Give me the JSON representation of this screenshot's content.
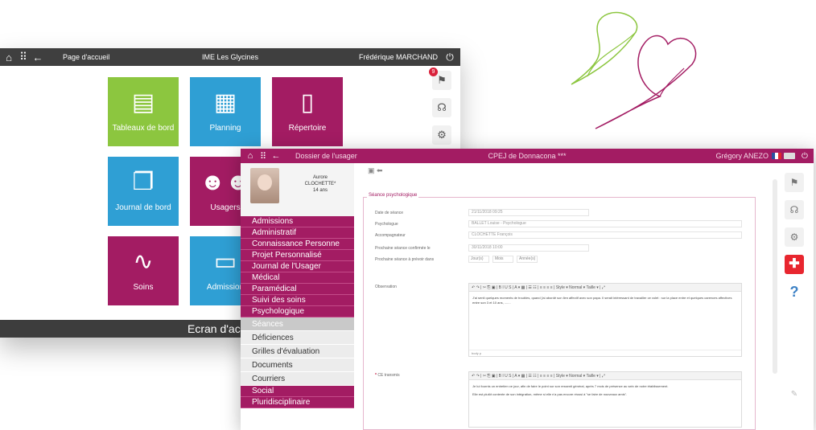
{
  "home_window": {
    "topbar": {
      "page_label": "Page d'accueil",
      "center_title": "IME Les Glycines",
      "user_name": "Frédérique MARCHAND"
    },
    "tiles": [
      {
        "label": "Tableaux de bord",
        "icon": "clipboard-icon",
        "color": "#8cc63f"
      },
      {
        "label": "Planning",
        "icon": "calendar-icon",
        "color": "#2f9fd4"
      },
      {
        "label": "Répertoire",
        "icon": "phone-icon",
        "color": "#a31c63"
      },
      {
        "label": "Journal de bord",
        "icon": "book-icon",
        "color": "#2f9fd4"
      },
      {
        "label": "Usagers",
        "icon": "users-icon",
        "color": "#a31c63"
      },
      {
        "label": "Soins",
        "icon": "stethoscope-icon",
        "color": "#a31c63"
      },
      {
        "label": "Admission",
        "icon": "id-card-icon",
        "color": "#2f9fd4"
      }
    ],
    "notification_count": "9",
    "bottom_caption": "Ecran d'ac"
  },
  "dossier_window": {
    "topbar": {
      "title": "Dossier de l'usager",
      "center_title": "CPEJ de Donnacona ***",
      "user_name": "Grégory ANEZO"
    },
    "patient": {
      "first_name": "Aurore",
      "last_name": "CLOCHETTE*",
      "age": "14 ans"
    },
    "menu": [
      {
        "label": "Admissions",
        "style": "magenta"
      },
      {
        "label": "Administratif",
        "style": "magenta"
      },
      {
        "label": "Connaissance Personne",
        "style": "magenta"
      },
      {
        "label": "Projet Personnalisé",
        "style": "magenta"
      },
      {
        "label": "Journal de l'Usager",
        "style": "magenta"
      },
      {
        "label": "Médical",
        "style": "magenta"
      },
      {
        "label": "Paramédical",
        "style": "magenta"
      },
      {
        "label": "Suivi des soins",
        "style": "magenta"
      },
      {
        "label": "Psychologique",
        "style": "magenta"
      },
      {
        "label": "Séances",
        "style": "selected"
      },
      {
        "label": "Déficiences",
        "style": "grey"
      },
      {
        "label": "Grilles d'évaluation",
        "style": "grey"
      },
      {
        "label": "Documents",
        "style": "grey"
      },
      {
        "label": "Courriers",
        "style": "grey"
      },
      {
        "label": "Social",
        "style": "magenta"
      },
      {
        "label": "Pluridisciplinaire",
        "style": "magenta"
      }
    ],
    "form": {
      "section_title": "Séance psychologique",
      "date_label": "Date de séance",
      "date_value": "21/11/2018 09:25",
      "psychologue_label": "Psychologue",
      "psychologue_value": "BALLET Louise - Psychologue",
      "accompagnateur_label": "Accompagnateur",
      "accompagnateur_value": "CLOCHETTE François",
      "prochaine_label": "Prochaine séance confirmée le",
      "prochaine_value": "30/11/2018 10:00",
      "prevoir_label": "Prochaine séance à prévoir dans",
      "prevoir_units": [
        "Jour(s)",
        "Mois",
        "Année(s)"
      ],
      "observations_label": "Observation",
      "observations_text": "J'ai senti quelques moments de troubles, quand j'ai abordé son lien affectif avec son papa. Il serait intéressant de travailler ce volet : sur la place entre et quelques carences affectives entre son 3 et 10 ans, .......",
      "ce_transmis_label": "CE transmis",
      "ce_transmis_text_1": "Je lui fournis un entretien ce jour, afin de faire le point sur son ressenti général, après 7 mois de présence au sein de notre établissement.",
      "ce_transmis_text_2": "Elle est plutôt contente de son intégration, même si elle n'a pas encore réussi à \"se faire de nouveaux amis\".",
      "editor_toolbar": "↶ ↷ | ✂ ⎘ ▣ | B I U S | A ▾ ▦ | ☰ ☷ | ≡ ≡ ≡ ≡ | Style ▾  Normal ▾  Taille ▾ | ⤢",
      "editor_footer": "body  p"
    }
  }
}
